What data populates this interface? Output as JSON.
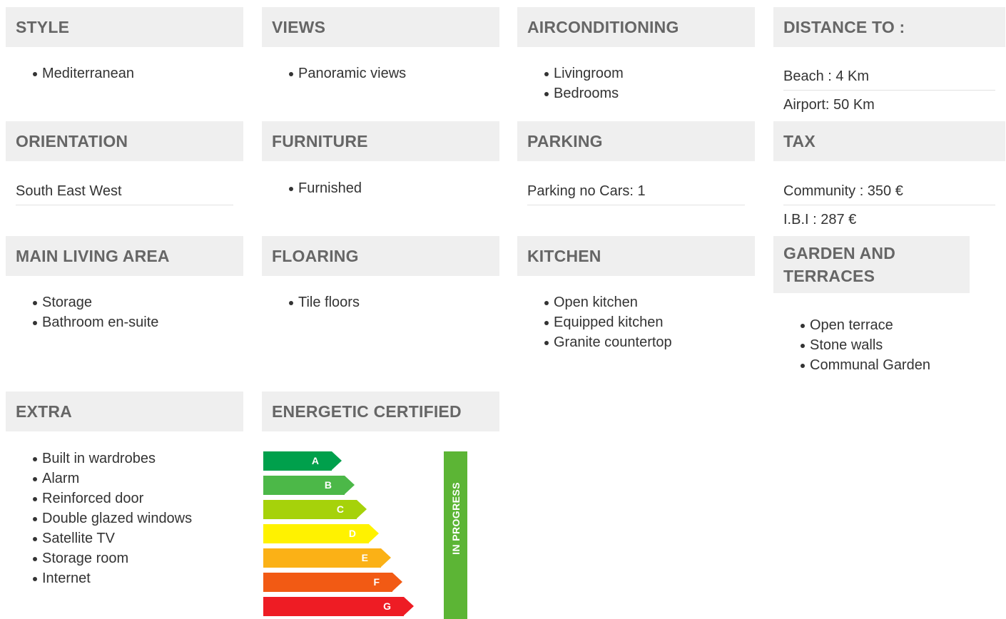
{
  "sections": {
    "style": {
      "title": "STYLE",
      "items": [
        "Mediterranean"
      ]
    },
    "views": {
      "title": "VIEWS",
      "items": [
        "Panoramic views"
      ]
    },
    "airconditioning": {
      "title": "AIRCONDITIONING",
      "items": [
        "Livingroom",
        "Bedrooms"
      ]
    },
    "distance": {
      "title": "DISTANCE TO :",
      "rows": [
        "Beach : 4 Km",
        "Airport: 50 Km"
      ]
    },
    "orientation": {
      "title": "ORIENTATION",
      "rows": [
        "South East West"
      ]
    },
    "furniture": {
      "title": "FURNITURE",
      "items": [
        "Furnished"
      ]
    },
    "parking": {
      "title": "PARKING",
      "rows": [
        "Parking no Cars: 1"
      ]
    },
    "tax": {
      "title": "TAX",
      "rows": [
        "Community : 350 €",
        "I.B.I : 287 €"
      ]
    },
    "main_living": {
      "title": "MAIN LIVING AREA",
      "items": [
        "Storage",
        "Bathroom en-suite"
      ]
    },
    "flooring": {
      "title": "FLOARING",
      "items": [
        "Tile floors"
      ]
    },
    "kitchen": {
      "title": "KITCHEN",
      "items": [
        "Open kitchen",
        "Equipped kitchen",
        "Granite countertop"
      ]
    },
    "garden": {
      "title": "GARDEN AND TERRACES",
      "items": [
        "Open terrace",
        "Stone walls",
        "Communal Garden"
      ]
    },
    "extra": {
      "title": "EXTRA",
      "items": [
        "Built in wardrobes",
        "Alarm",
        "Reinforced door",
        "Double glazed windows",
        "Satellite TV",
        "Storage room",
        "Internet"
      ]
    },
    "energetic": {
      "title": "ENERGETIC CERTIFIED"
    }
  },
  "energy": {
    "classes": [
      {
        "label": "A",
        "color": "#00a04c"
      },
      {
        "label": "B",
        "color": "#4cb848"
      },
      {
        "label": "C",
        "color": "#a6d20a"
      },
      {
        "label": "D",
        "color": "#fff200"
      },
      {
        "label": "E",
        "color": "#fbb116"
      },
      {
        "label": "F",
        "color": "#f25a14"
      },
      {
        "label": "G",
        "color": "#ee1c24"
      }
    ],
    "status": "IN PROGRESS",
    "status_color": "#5cb535"
  }
}
